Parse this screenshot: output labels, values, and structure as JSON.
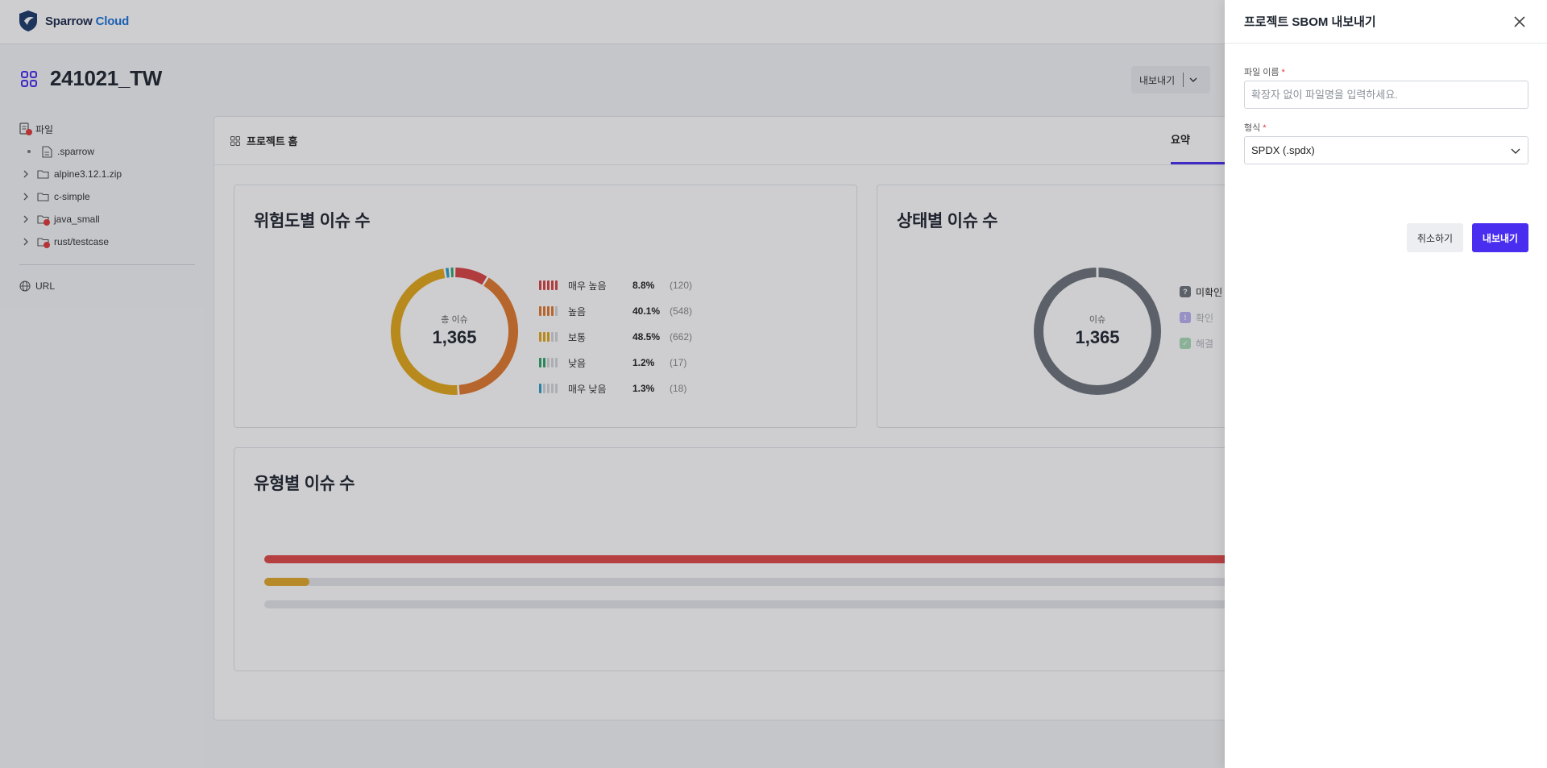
{
  "header": {
    "logo_text_1": "Sparrow",
    "logo_text_2": "Cloud"
  },
  "page": {
    "title": "241021_TW",
    "export_dropdown_label": "내보내기"
  },
  "sidebar": {
    "file_section_label": "파일",
    "items": [
      {
        "label": ".sparrow",
        "type": "file"
      },
      {
        "label": "alpine3.12.1.zip",
        "type": "folder"
      },
      {
        "label": "c-simple",
        "type": "folder"
      },
      {
        "label": "java_small",
        "type": "folder",
        "alert": true
      },
      {
        "label": "rust/testcase",
        "type": "folder",
        "alert": true
      }
    ],
    "url_label": "URL"
  },
  "main": {
    "header_title": "프로젝트 홈",
    "tab_summary": "요약",
    "risk_panel": {
      "title": "위험도별 이슈 수",
      "center_label": "총 이슈",
      "center_value": "1,365",
      "rows": [
        {
          "label": "매우 높음",
          "pct": "8.8%",
          "count": "(120)",
          "color": "#d94545",
          "level": 5
        },
        {
          "label": "높음",
          "pct": "40.1%",
          "count": "(548)",
          "color": "#e07a2e",
          "level": 4
        },
        {
          "label": "보통",
          "pct": "48.5%",
          "count": "(662)",
          "color": "#e3a81c",
          "level": 3
        },
        {
          "label": "낮음",
          "pct": "1.2%",
          "count": "(17)",
          "color": "#2ea66a",
          "level": 2
        },
        {
          "label": "매우 낮음",
          "pct": "1.3%",
          "count": "(18)",
          "color": "#2a9fc9",
          "level": 1
        }
      ]
    },
    "status_panel": {
      "title": "상태별 이슈 수",
      "center_label": "이슈",
      "center_value": "1,365",
      "rows": [
        {
          "label": "미확인",
          "icon": "?",
          "color": "#6c737c"
        },
        {
          "label": "확인",
          "icon": "!",
          "color": "#b9b1f1"
        },
        {
          "label": "해결",
          "icon": "✓",
          "color": "#a8dcb6"
        }
      ]
    },
    "type_panel": {
      "title": "유형별 이슈 수"
    }
  },
  "drawer": {
    "title": "프로젝트 SBOM 내보내기",
    "filename_label": "파일 이름",
    "filename_placeholder": "확장자 없이 파일명을 입력하세요.",
    "filename_value": "",
    "format_label": "형식",
    "format_value": "SPDX (.spdx)",
    "cancel_label": "취소하기",
    "export_label": "내보내기"
  },
  "colors": {
    "accent": "#4a2ef0",
    "required": "#e03a3a"
  }
}
